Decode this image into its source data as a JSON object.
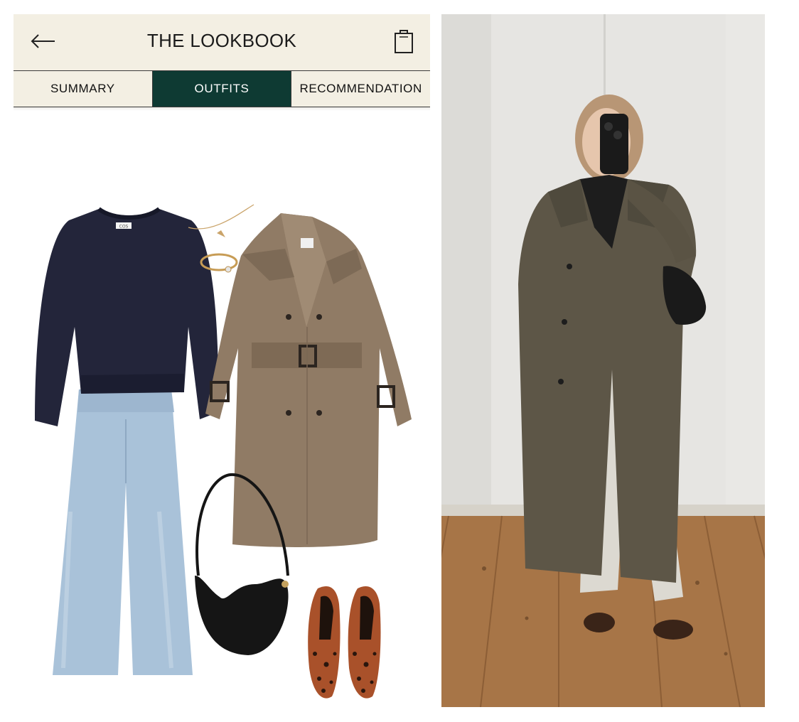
{
  "header": {
    "title": "THE LOOKBOOK",
    "back_icon": "arrow-left-icon",
    "cart_icon": "shopping-bag-icon"
  },
  "tabs": [
    {
      "label": "SUMMARY",
      "active": false
    },
    {
      "label": "OUTFITS",
      "active": true
    },
    {
      "label": "RECOMMENDATION",
      "active": false
    }
  ],
  "outfit_items": [
    {
      "item": "navy knit sweater",
      "tag_text": "COS"
    },
    {
      "item": "gold chain necklace"
    },
    {
      "item": "gold ring"
    },
    {
      "item": "taupe belted trench coat"
    },
    {
      "item": "light wash wide-leg jeans"
    },
    {
      "item": "black crescent shoulder bag"
    },
    {
      "item": "leopard print flats"
    }
  ],
  "colors": {
    "header_bg": "#f3efe3",
    "active_tab_bg": "#0e3a33",
    "active_tab_text": "#ffffff"
  }
}
